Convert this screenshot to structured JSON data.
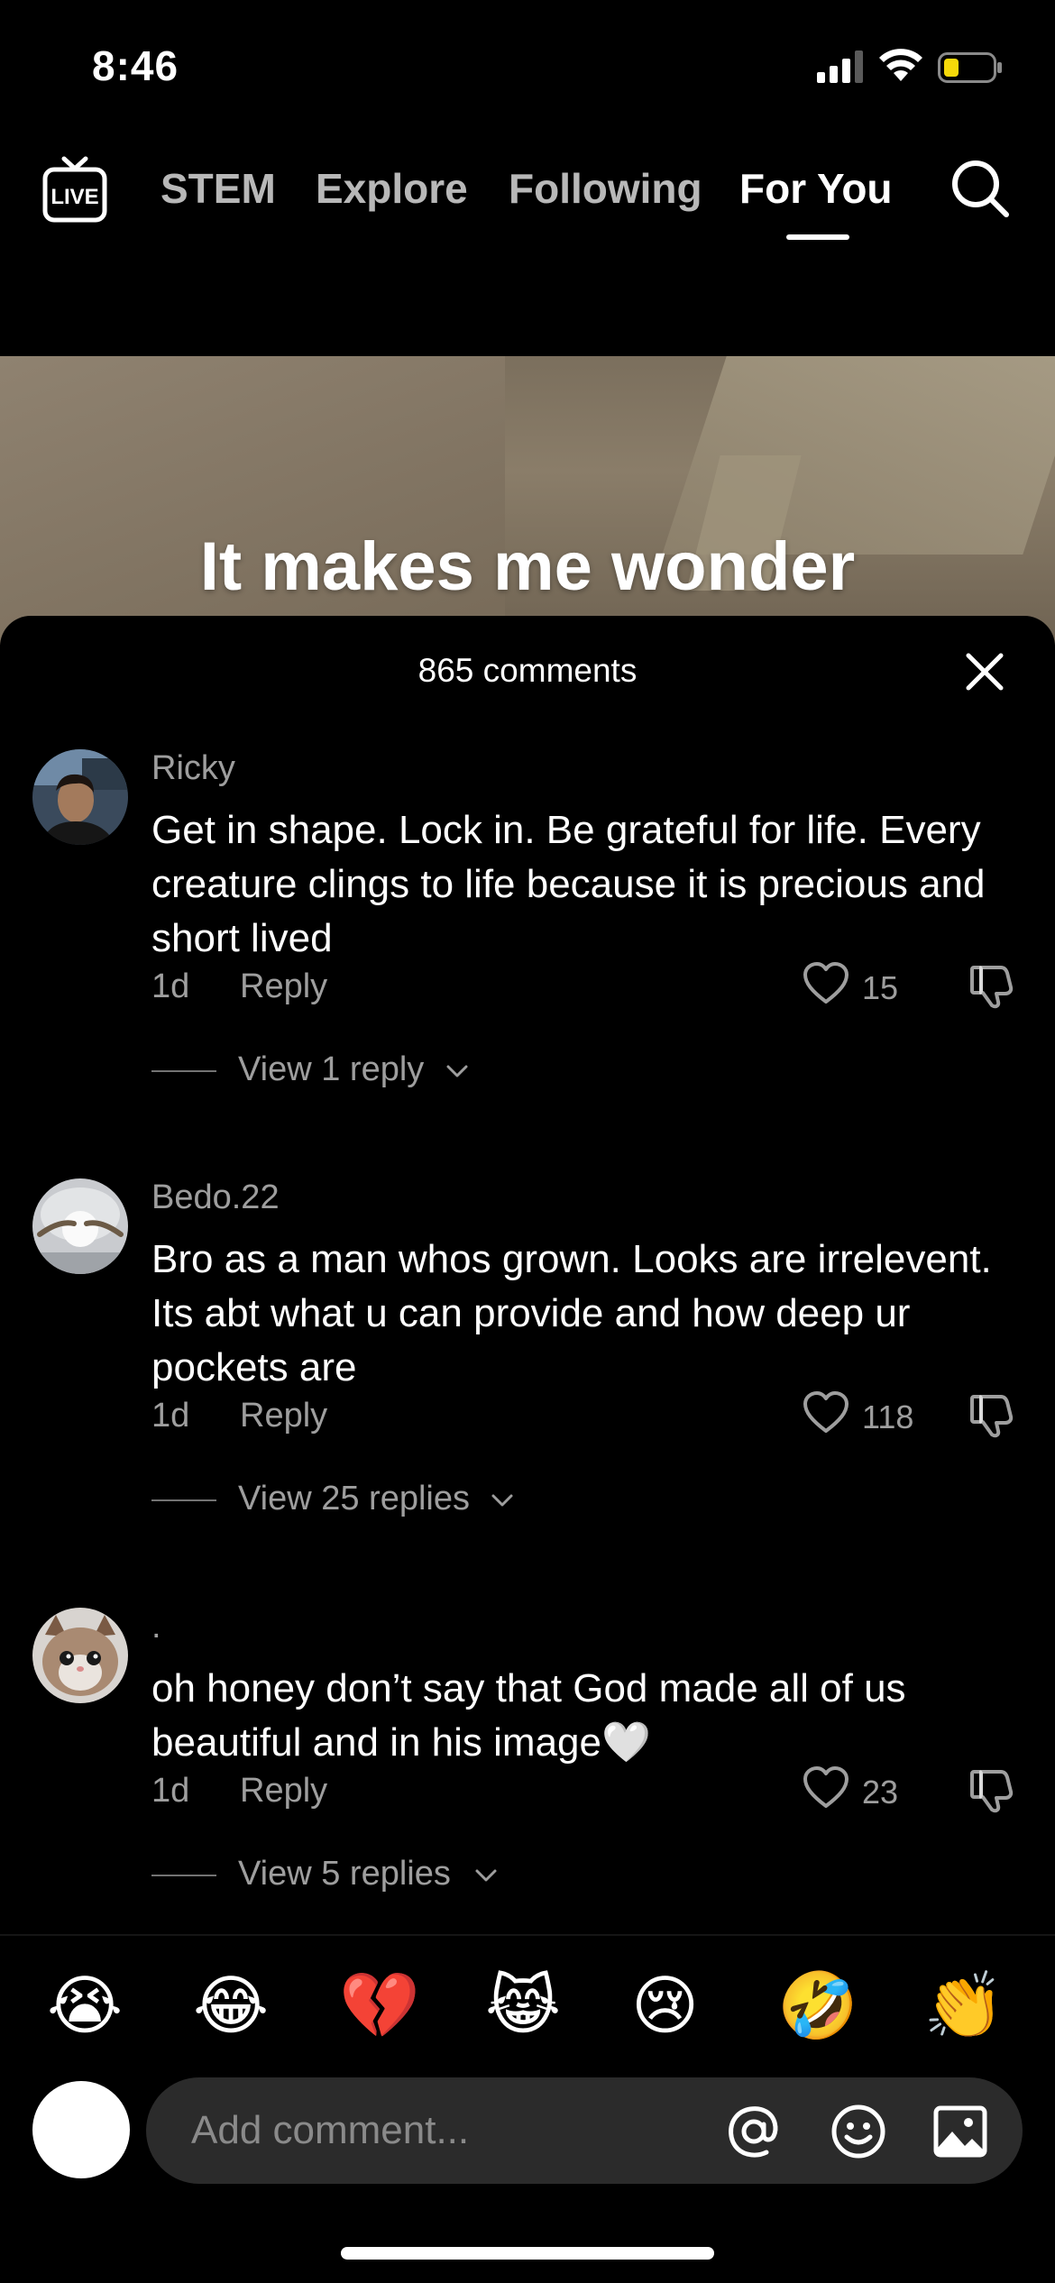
{
  "status_bar": {
    "time": "8:46"
  },
  "top_nav": {
    "live_icon": "live-tv-icon",
    "tabs": [
      {
        "label": "STEM"
      },
      {
        "label": "Explore"
      },
      {
        "label": "Following"
      },
      {
        "label": "For You"
      }
    ],
    "active_tab": "For You",
    "search_icon": "search-icon"
  },
  "video": {
    "caption": "It makes me wonder"
  },
  "comments_sheet": {
    "count_label": "865 comments",
    "comments": [
      {
        "username": "Ricky",
        "text": "Get in shape. Lock in. Be grateful for life. Every creature clings to life because it is precious and short lived",
        "time": "1d",
        "reply_label": "Reply",
        "likes": "15",
        "view_replies": "View 1 reply"
      },
      {
        "username": "Bedo.22",
        "text": "Bro as a man whos grown. Looks are irrelevent. Its abt what u can provide and how deep ur pockets are",
        "time": "1d",
        "reply_label": "Reply",
        "likes": "118",
        "view_replies": "View 25 replies"
      },
      {
        "username": ".",
        "text": "oh honey don’t say that God made all of us beautiful and in his image🤍",
        "time": "1d",
        "reply_label": "Reply",
        "likes": "23",
        "view_replies": "View 5 replies"
      }
    ]
  },
  "emoji_bar": [
    "😭",
    "😂",
    "💔",
    "😹",
    "😢",
    "🤣",
    "👏"
  ],
  "input": {
    "placeholder": "Add comment..."
  }
}
